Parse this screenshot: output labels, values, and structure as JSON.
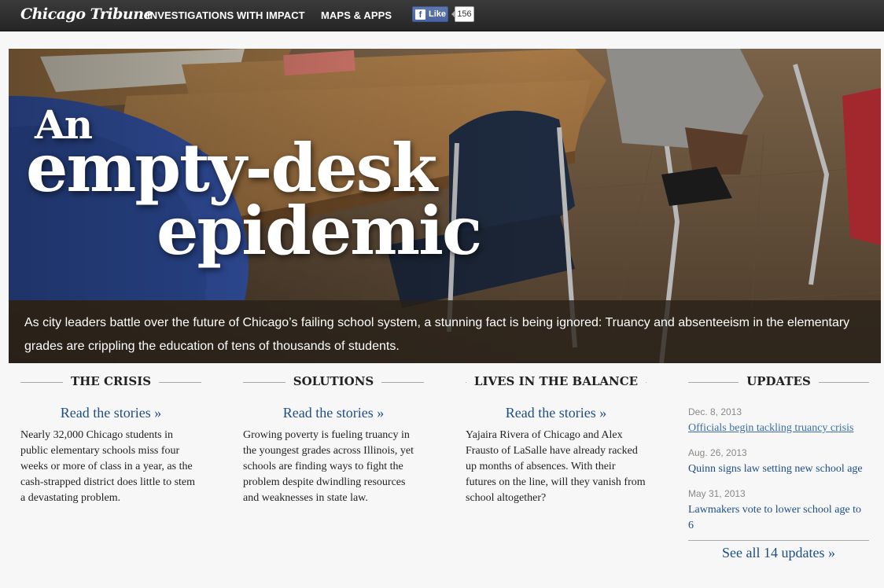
{
  "topbar": {
    "logo": "Chicago Tribune",
    "nav": [
      "INVESTIGATIONS WITH IMPACT",
      "MAPS & APPS"
    ],
    "fb_like_label": "Like",
    "fb_count": "156",
    "fb_icon": "f"
  },
  "hero": {
    "headline_line1": "An",
    "headline_line2": "empty-desk",
    "headline_line3": "epidemic",
    "dek": "As city leaders battle over the future of Chicago’s failing school system, a stunning fact is being ignored: Truancy and absenteeism in the elementary grades are crippling the education of tens of thousands of students."
  },
  "sections": [
    {
      "heading": "THE CRISIS",
      "link": "Read the stories »",
      "blurb": "Nearly 32,000 Chicago students in public elementary schools miss four weeks or more of class in a year, as the cash-strapped district does little to stem a devastating problem."
    },
    {
      "heading": "SOLUTIONS",
      "link": "Read the stories »",
      "blurb": "Growing poverty is fueling truancy in the youngest grades across Illinois, yet schools are finding ways to fight the problem despite dwindling resources and weaknesses in state law."
    },
    {
      "heading": "LIVES IN THE BALANCE",
      "link": "Read the stories »",
      "blurb": "Yajaira Rivera of Chicago and Alex Frausto of LaSalle have already racked up months of absences. With their futures on the line, will they vanish from school altogether?"
    }
  ],
  "updates": {
    "heading": "UPDATES",
    "items": [
      {
        "date": "Dec. 8, 2013",
        "title": "Officials begin tackling truancy crisis"
      },
      {
        "date": "Aug. 26, 2013",
        "title": "Quinn signs law setting new school age"
      },
      {
        "date": "May 31, 2013",
        "title": "Lawmakers vote to lower school age to 6"
      }
    ],
    "see_all": "See all 14 updates »"
  },
  "colors": {
    "topbar": "#2e2e2e",
    "link": "#1d4e89",
    "facebook": "#3b5998",
    "page_bg": "#f7f7f7"
  }
}
